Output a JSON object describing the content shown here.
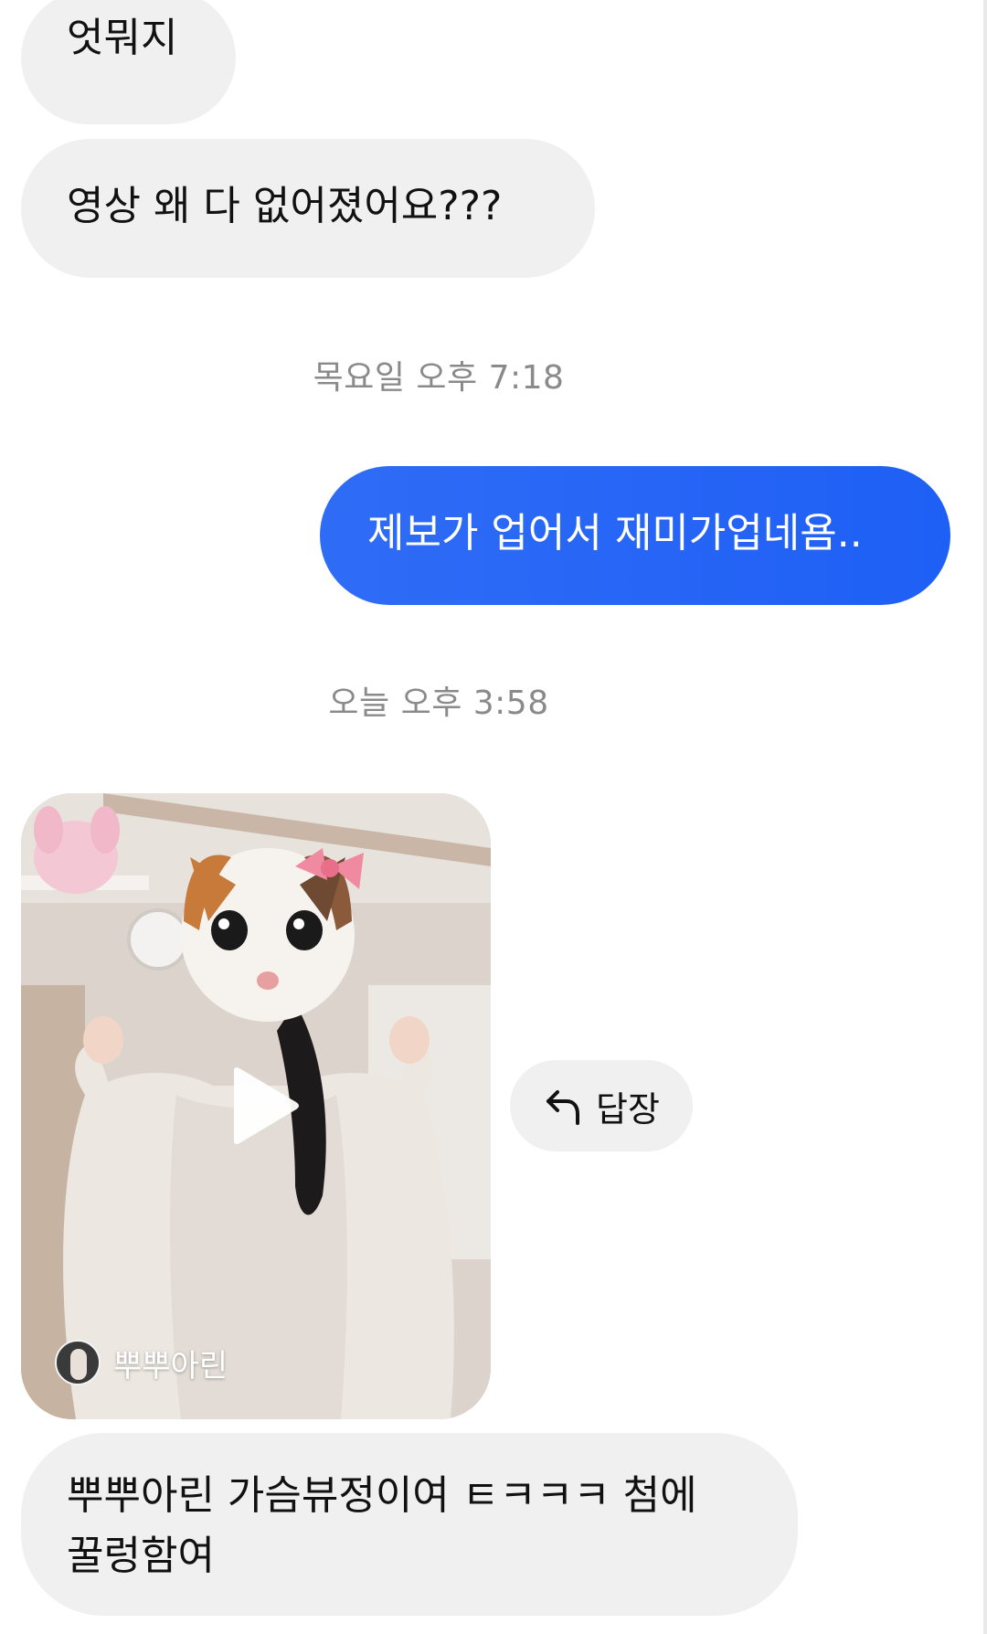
{
  "conversation": {
    "messages": [
      {
        "direction": "incoming",
        "text": "엇뭐지"
      },
      {
        "direction": "incoming",
        "text": "영상 왜 다 없어졌어요???"
      },
      {
        "direction": "outgoing",
        "text": "제보가 업어서 재미가업네욤.."
      },
      {
        "direction": "incoming",
        "text_line1": "뿌뿌아린 가슴뷰정이여 ㅌㅋㅋㅋ 첨에",
        "text_line2": "꿀렁함여"
      }
    ],
    "timestamps": [
      "목요일 오후 7:18",
      "오늘 오후 3:58"
    ],
    "shared_video": {
      "author": "뿌뿌아린",
      "play_icon": "play-icon"
    },
    "reply_button": {
      "label": "답장",
      "icon": "reply-arrow-icon"
    }
  },
  "colors": {
    "incoming_bubble": "#f0f0f0",
    "outgoing_bubble": "#2563f5",
    "timestamp_text": "#8a8a8a"
  }
}
